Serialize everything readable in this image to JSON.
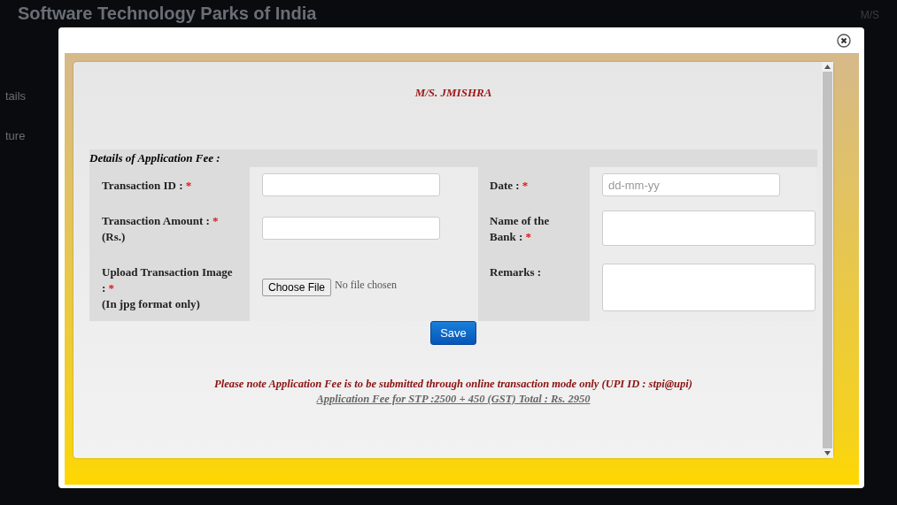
{
  "background": {
    "site_title": "Software Technology Parks of India",
    "user": "M/S",
    "menu_items": [
      "tails",
      "ture"
    ]
  },
  "dialog": {
    "company": "M/S. JMISHRA",
    "section_title": "Details of Application Fee :",
    "rows": [
      {
        "left": {
          "kind": "text",
          "label": "Transaction ID :",
          "required": true
        },
        "right": {
          "kind": "date",
          "label": "Date :",
          "required": true,
          "placeholder": "dd-mm-yy"
        }
      },
      {
        "left": {
          "kind": "text",
          "label": "Transaction Amount :",
          "required": true,
          "note": "(Rs.)"
        },
        "right": {
          "kind": "text",
          "label": "Name of the Bank :",
          "required": true
        }
      },
      {
        "left": {
          "kind": "file",
          "label": "Upload Transaction Image :",
          "required": true,
          "note": "(In jpg format only)",
          "button": "Choose File",
          "status": "No file chosen"
        },
        "right": {
          "kind": "textarea",
          "label": "Remarks :",
          "required": false
        }
      }
    ],
    "required_mark": "*",
    "save": "Save",
    "note": "Please note Application Fee is to be submitted through online transaction mode only (UPI ID : stpi@upi)",
    "fee": "Application Fee for STP :2500 + 450 (GST) Total : Rs. 2950"
  }
}
